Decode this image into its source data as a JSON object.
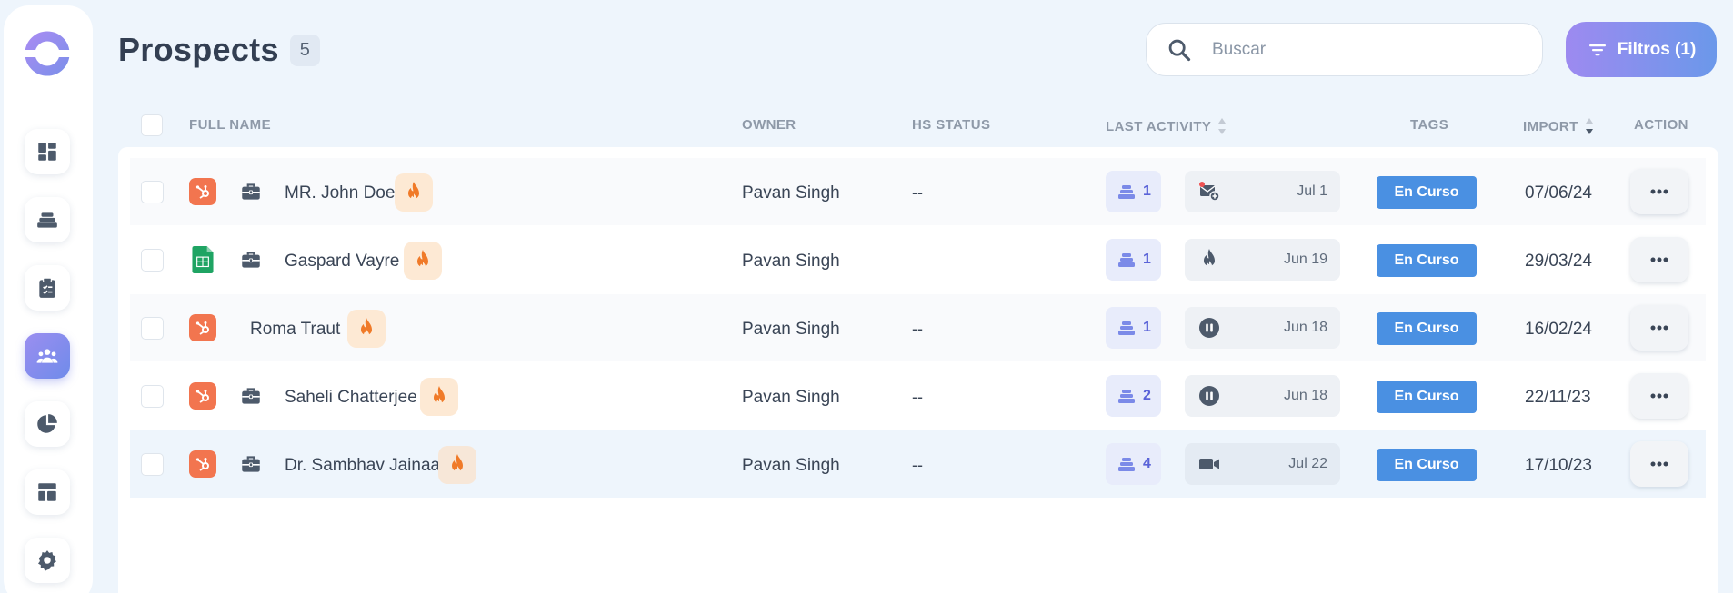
{
  "page": {
    "title": "Prospects",
    "count": "5"
  },
  "search": {
    "placeholder": "Buscar"
  },
  "filters": {
    "label": "Filtros (1)"
  },
  "columns": {
    "full_name": "FULL NAME",
    "owner": "OWNER",
    "hs_status": "HS STATUS",
    "last_activity": "LAST ACTIVITY",
    "tags": "TAGS",
    "import": "IMPORT",
    "action": "ACTION"
  },
  "sidebar": {
    "items": [
      {
        "icon": "dashboard-icon"
      },
      {
        "icon": "sequences-icon"
      },
      {
        "icon": "clipboard-icon"
      },
      {
        "icon": "people-icon",
        "active": true
      },
      {
        "icon": "pie-chart-icon"
      },
      {
        "icon": "template-icon"
      },
      {
        "icon": "gear-icon"
      }
    ]
  },
  "rows": [
    {
      "source": "hubspot",
      "briefcase": true,
      "name": "MR. John Doe",
      "owner": "Pavan Singh",
      "hs_status": "--",
      "sequences": "1",
      "activity_icon": "email-add-icon",
      "activity_date": "Jul 1",
      "tag": "En Curso",
      "import": "07/06/24"
    },
    {
      "source": "sheets",
      "briefcase": true,
      "name": "Gaspard Vayre",
      "owner": "Pavan Singh",
      "hs_status": "",
      "sequences": "1",
      "activity_icon": "fire-icon",
      "activity_date": "Jun 19",
      "tag": "En Curso",
      "import": "29/03/24"
    },
    {
      "source": "hubspot",
      "briefcase": false,
      "name": "Roma Traut",
      "owner": "Pavan Singh",
      "hs_status": "--",
      "sequences": "1",
      "activity_icon": "pause-icon",
      "activity_date": "Jun 18",
      "tag": "En Curso",
      "import": "16/02/24"
    },
    {
      "source": "hubspot",
      "briefcase": true,
      "name": "Saheli Chatterjee",
      "owner": "Pavan Singh",
      "hs_status": "--",
      "sequences": "2",
      "activity_icon": "pause-icon",
      "activity_date": "Jun 18",
      "tag": "En Curso",
      "import": "22/11/23"
    },
    {
      "source": "hubspot",
      "briefcase": true,
      "name": "Dr. Sambhav Jainaa",
      "owner": "Pavan Singh",
      "hs_status": "--",
      "sequences": "4",
      "activity_icon": "video-icon",
      "activity_date": "Jul 22",
      "tag": "En Curso",
      "import": "17/10/23"
    }
  ],
  "colors": {
    "accent": "#4a90e2",
    "hubspot": "#f2754f",
    "sheets": "#1fa463",
    "fire": "#f07a28",
    "primary_gradient_start": "#9d8af0",
    "primary_gradient_end": "#6b98ea"
  }
}
